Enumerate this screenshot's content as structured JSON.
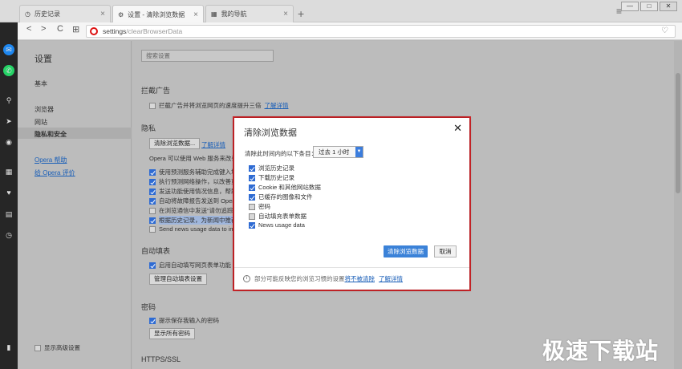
{
  "tabs": [
    {
      "label": "历史记录",
      "icon": "clock-icon",
      "close": "×"
    },
    {
      "label": "设置 - 清除浏览数据",
      "icon": "gear-icon",
      "close": "×"
    },
    {
      "label": "我的导航",
      "icon": "grid-icon",
      "close": "×"
    }
  ],
  "new_tab": "+",
  "menu": "≡",
  "window_controls": {
    "minimize": "—",
    "maximize": "□",
    "close": "✕"
  },
  "toolbar": {
    "back": "<",
    "forward": ">",
    "reload": "C",
    "tabs_view": "⊞",
    "url_scheme": "settings",
    "url_path": "/clearBrowserData",
    "bookmark": "♡"
  },
  "sidebar_icons": [
    "messenger-icon",
    "whatsapp-icon",
    "search-icon",
    "send-icon",
    "camera-icon",
    "speed-dial-icon",
    "heart-icon",
    "news-icon",
    "history-icon",
    "sidebar-toggle-icon"
  ],
  "settings": {
    "title": "设置",
    "nav": [
      "基本",
      "浏览器",
      "网站",
      "隐私和安全"
    ],
    "help": "Opera 帮助",
    "rate": "给 Opera 评价",
    "show_advanced": "显示高级设置",
    "search_placeholder": "搜索设置"
  },
  "sections": {
    "adblock": {
      "heading": "拦截广告",
      "option": "拦截广告并将浏览网页的速度提升三倍",
      "learn_more": "了解详情"
    },
    "privacy": {
      "heading": "隐私",
      "clear_btn": "清除浏览数据...",
      "learn_more": "了解详情",
      "desc": "Opera 可以使用 Web 服务来改善",
      "items": [
        {
          "label": "使用预测服务辅助完成键入地",
          "checked": true
        },
        {
          "label": "执行预测网络操作，以改善页",
          "checked": true
        },
        {
          "label": "发送功能使用情况信息，帮助",
          "checked": true
        },
        {
          "label": "自动将故障报告发送到 Opera",
          "checked": true
        },
        {
          "label": "在浏览通信中发送“请勿追踪",
          "checked": false
        },
        {
          "label": "根据历史记录，为新闻中推荐",
          "checked": true
        },
        {
          "label": "Send news usage data to im",
          "checked": false
        }
      ]
    },
    "autofill": {
      "heading": "自动填表",
      "option": "启用自动填写网页表单功能",
      "manage_btn": "管理自动填表设置"
    },
    "passwords": {
      "heading": "密码",
      "option": "提示保存我输入的密码",
      "show_btn": "显示所有密码"
    },
    "https": {
      "heading": "HTTPS/SSL"
    }
  },
  "dialog": {
    "title": "清除浏览数据",
    "close": "✕",
    "period_label": "清除此时间内的以下条目：",
    "period_value": "过去 1 小时",
    "period_arrow": "▼",
    "items": [
      {
        "label": "浏览历史记录",
        "checked": true
      },
      {
        "label": "下载历史记录",
        "checked": true
      },
      {
        "label": "Cookie 和其他网站数据",
        "checked": true
      },
      {
        "label": "已缓存的图像和文件",
        "checked": true
      },
      {
        "label": "密码",
        "checked": false
      },
      {
        "label": "自动填充表单数据",
        "checked": false
      },
      {
        "label": "News usage data",
        "checked": true
      }
    ],
    "clear_btn": "清除浏览数据",
    "cancel_btn": "取消",
    "footer_text": "部分可能反映您的浏览习惯的设置",
    "footer_link1": "将不被清除",
    "footer_link2": "了解详情",
    "info": "i"
  },
  "watermark": "极速下载站",
  "colors": {
    "accent": "#3b82d8",
    "opera_red": "#e2211c",
    "highlight": "#d2262a"
  }
}
